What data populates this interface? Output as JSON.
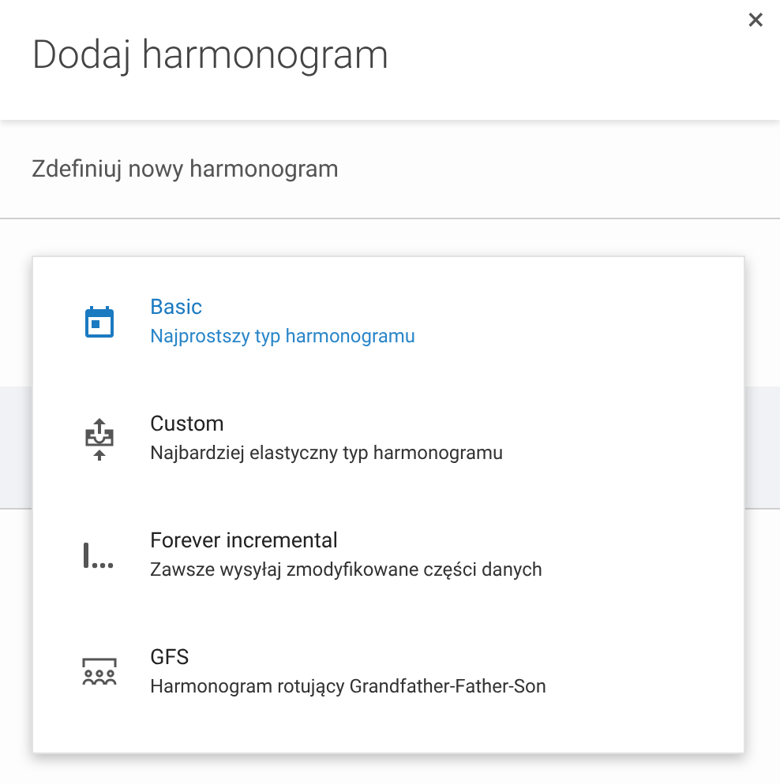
{
  "dialog": {
    "title": "Dodaj harmonogram",
    "close": "×",
    "subtitle": "Zdefiniuj nowy harmonogram"
  },
  "menu": {
    "items": [
      {
        "kind": "calendar",
        "label": "Basic",
        "description": "Najprostszy typ harmonogramu",
        "selected": true
      },
      {
        "kind": "upload",
        "label": "Custom",
        "description": "Najbardziej elastyczny typ harmonogramu",
        "selected": false
      },
      {
        "kind": "incremental",
        "label": "Forever incremental",
        "description": "Zawsze wysyłaj zmodyfikowane części danych",
        "selected": false
      },
      {
        "kind": "gfs",
        "label": "GFS",
        "description": "Harmonogram rotujący Grandfather-Father-Son",
        "selected": false
      }
    ]
  }
}
